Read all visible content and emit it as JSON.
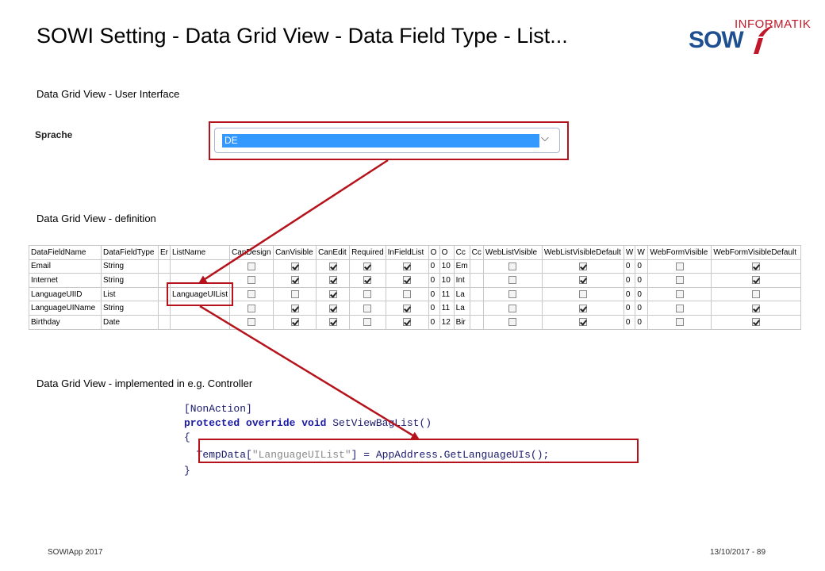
{
  "slide": {
    "title": "SOWI Setting - Data Grid View - Data Field Type - List...",
    "logo": {
      "top_text": "INFORMATIK",
      "main_text": "SOW",
      "accent_color": "#c0182a",
      "main_color": "#1d4f91"
    },
    "section_ui": "Data Grid View - User Interface",
    "section_def": "Data Grid View - definition",
    "section_impl": "Data Grid View - implemented  in e.g. Controller",
    "footer_left": "SOWIApp 2017",
    "footer_right": "13/10/2017 - 89",
    "highlight_color": "#b5121b"
  },
  "ui": {
    "label": "Sprache",
    "dropdown_value": "DE",
    "dropdown_icon": "chevron-down-icon"
  },
  "grid": {
    "headers": [
      "DataFieldName",
      "DataFieldType",
      "Er",
      "ListName",
      "CanDesign",
      "CanVisible",
      "CanEdit",
      "Required",
      "InFieldList",
      "O",
      "O",
      "Cc",
      "Cc",
      "WebListVisible",
      "WebListVisibleDefault",
      "W",
      "W",
      "WebFormVisible",
      "WebFormVisibleDefault"
    ],
    "rows": [
      {
        "name": "Email",
        "type": "String",
        "list": "",
        "cd": false,
        "cv": true,
        "ce": true,
        "req": true,
        "ifl": true,
        "o1": "0",
        "o2": "10",
        "c1": "Em",
        "wlv": false,
        "wlvd": true,
        "w1": "0",
        "w2": "0",
        "wfv": false,
        "wfvd": true
      },
      {
        "name": "Internet",
        "type": "String",
        "list": "",
        "cd": false,
        "cv": true,
        "ce": true,
        "req": true,
        "ifl": true,
        "o1": "0",
        "o2": "10",
        "c1": "Int",
        "wlv": false,
        "wlvd": true,
        "w1": "0",
        "w2": "0",
        "wfv": false,
        "wfvd": true
      },
      {
        "name": "LanguageUIID",
        "type": "List",
        "list": "LanguageUIList",
        "cd": false,
        "cv": false,
        "ce": true,
        "req": false,
        "ifl": false,
        "o1": "0",
        "o2": "11",
        "c1": "La",
        "wlv": false,
        "wlvd": false,
        "w1": "0",
        "w2": "0",
        "wfv": false,
        "wfvd": false
      },
      {
        "name": "LanguageUIName",
        "type": "String",
        "list": "",
        "cd": false,
        "cv": true,
        "ce": true,
        "req": false,
        "ifl": true,
        "o1": "0",
        "o2": "11",
        "c1": "La",
        "wlv": false,
        "wlvd": true,
        "w1": "0",
        "w2": "0",
        "wfv": false,
        "wfvd": true
      },
      {
        "name": "Birthday",
        "type": "Date",
        "list": "",
        "cd": false,
        "cv": true,
        "ce": true,
        "req": false,
        "ifl": true,
        "o1": "0",
        "o2": "12",
        "c1": "Bir",
        "wlv": false,
        "wlvd": true,
        "w1": "0",
        "w2": "0",
        "wfv": false,
        "wfvd": true
      }
    ]
  },
  "code": {
    "line1": "[NonAction]",
    "line2_kw": "protected override void",
    "line2_rest": " SetViewBagList()",
    "line3": "{",
    "line4_a": "  TempData[",
    "line4_str": "\"LanguageUIList\"",
    "line4_b": "] = AppAddress.GetLanguageUIs();",
    "line5": "}"
  }
}
